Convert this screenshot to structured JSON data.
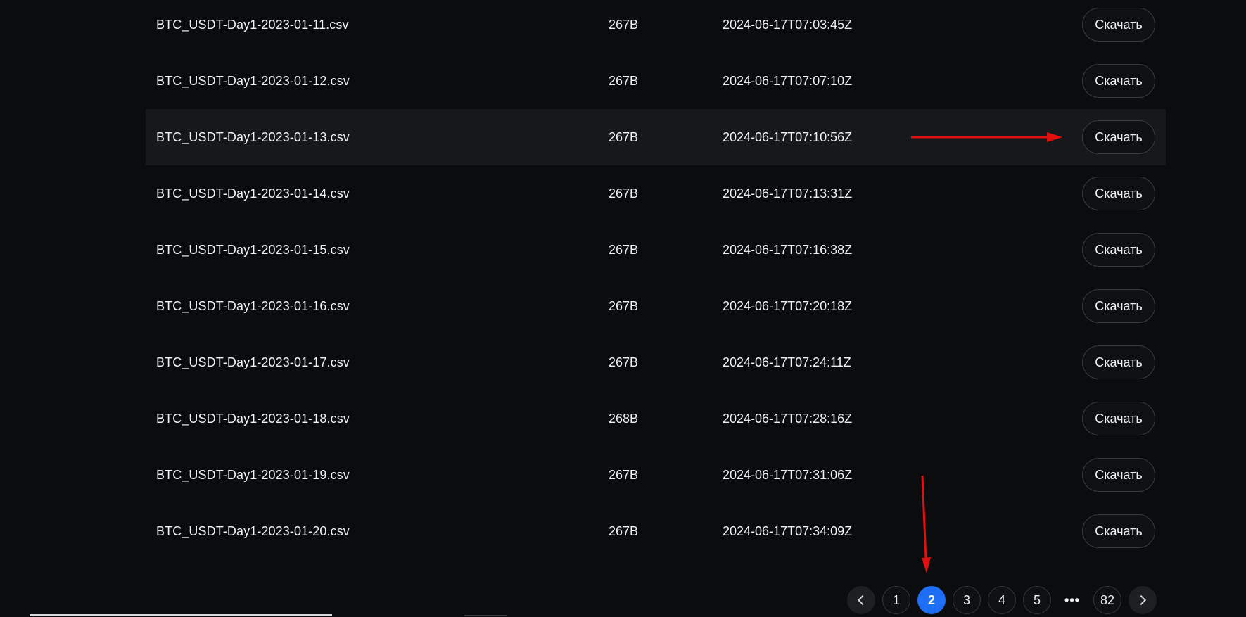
{
  "files": [
    {
      "name": "BTC_USDT-Day1-2023-01-11.csv",
      "size": "267B",
      "date": "2024-06-17T07:03:45Z"
    },
    {
      "name": "BTC_USDT-Day1-2023-01-12.csv",
      "size": "267B",
      "date": "2024-06-17T07:07:10Z"
    },
    {
      "name": "BTC_USDT-Day1-2023-01-13.csv",
      "size": "267B",
      "date": "2024-06-17T07:10:56Z"
    },
    {
      "name": "BTC_USDT-Day1-2023-01-14.csv",
      "size": "267B",
      "date": "2024-06-17T07:13:31Z"
    },
    {
      "name": "BTC_USDT-Day1-2023-01-15.csv",
      "size": "267B",
      "date": "2024-06-17T07:16:38Z"
    },
    {
      "name": "BTC_USDT-Day1-2023-01-16.csv",
      "size": "267B",
      "date": "2024-06-17T07:20:18Z"
    },
    {
      "name": "BTC_USDT-Day1-2023-01-17.csv",
      "size": "267B",
      "date": "2024-06-17T07:24:11Z"
    },
    {
      "name": "BTC_USDT-Day1-2023-01-18.csv",
      "size": "268B",
      "date": "2024-06-17T07:28:16Z"
    },
    {
      "name": "BTC_USDT-Day1-2023-01-19.csv",
      "size": "267B",
      "date": "2024-06-17T07:31:06Z"
    },
    {
      "name": "BTC_USDT-Day1-2023-01-20.csv",
      "size": "267B",
      "date": "2024-06-17T07:34:09Z"
    }
  ],
  "download_label": "Скачать",
  "pagination": {
    "pages": [
      "1",
      "2",
      "3",
      "4",
      "5"
    ],
    "active": "2",
    "ellipsis": "•••",
    "last": "82"
  },
  "colors": {
    "background": "#0b0c0e",
    "row_highlight": "#17181b",
    "active_page": "#1e6ef5",
    "annotation_arrow": "#e01010"
  }
}
